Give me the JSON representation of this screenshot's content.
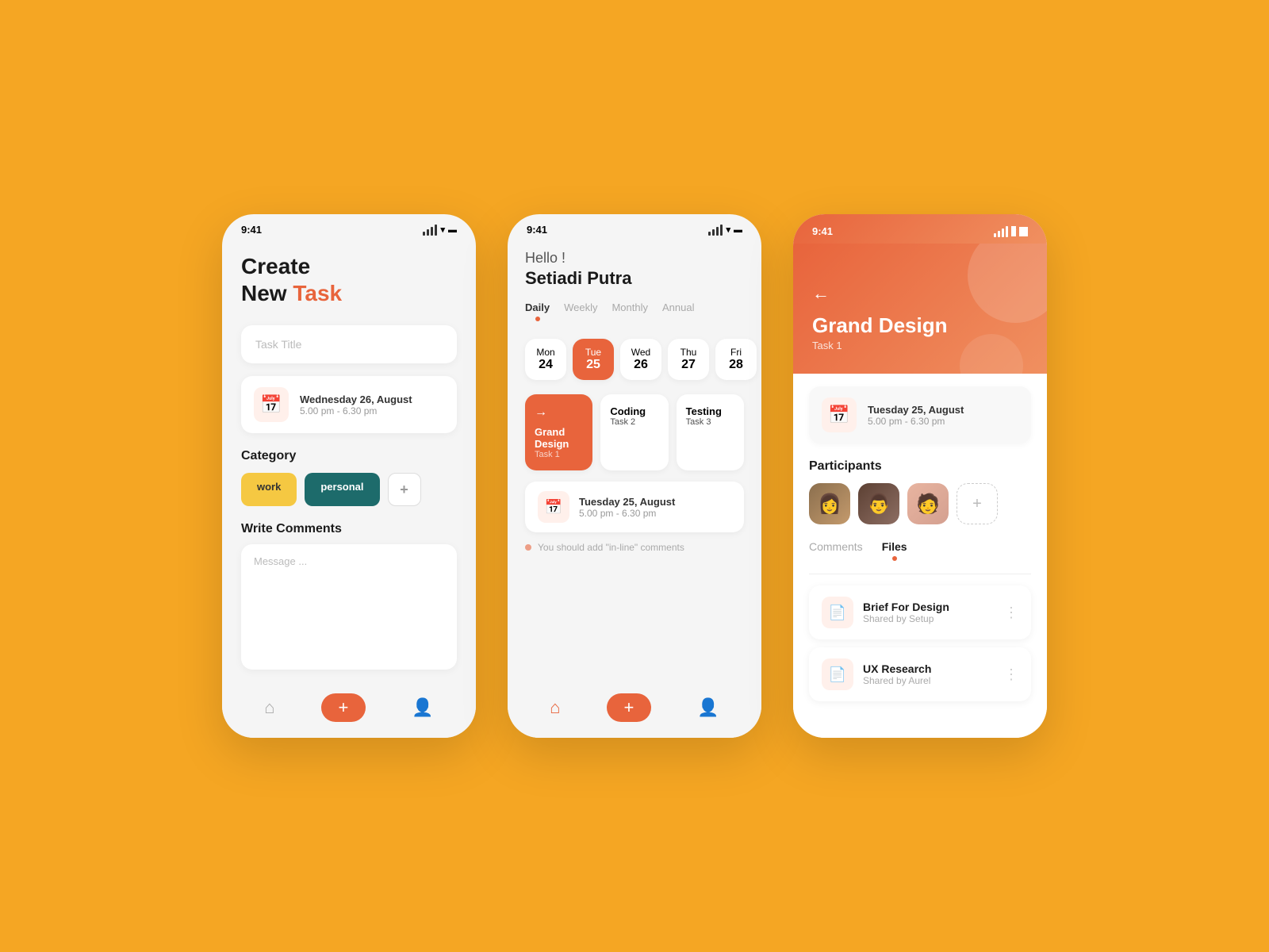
{
  "background": "#F5A623",
  "phone1": {
    "status_time": "9:41",
    "title_line1": "Create",
    "title_line2": "New ",
    "title_highlight": "Task",
    "task_input_placeholder": "Task Title",
    "date_main": "Wednesday 26, August",
    "date_sub": "5.00 pm - 6.30 pm",
    "category_label": "Category",
    "tag_work": "work",
    "tag_personal": "personal",
    "comments_label": "Write Comments",
    "message_placeholder": "Message ..."
  },
  "phone2": {
    "status_time": "9:41",
    "greeting": "Hello !",
    "user_name": "Setiadi Putra",
    "filter_tabs": [
      "Daily",
      "Weekly",
      "Monthly",
      "Annual"
    ],
    "active_tab": "Daily",
    "days": [
      {
        "name": "Mon",
        "num": "24",
        "active": false
      },
      {
        "name": "Tue",
        "num": "25",
        "active": true
      },
      {
        "name": "Wed",
        "num": "26",
        "active": false
      },
      {
        "name": "Thu",
        "num": "27",
        "active": false
      },
      {
        "name": "Fri",
        "num": "28",
        "active": false
      }
    ],
    "tasks": [
      {
        "name": "Grand Design",
        "sub": "Task 1",
        "featured": true,
        "arrow": "→"
      },
      {
        "name": "Coding",
        "sub": "Task 2",
        "featured": false
      },
      {
        "name": "Testing",
        "sub": "Task 3",
        "featured": false
      }
    ],
    "event_date": "Tuesday 25, August",
    "event_time": "5.00 pm - 6.30 pm",
    "comment_hint": "You should add \"in-line\" comments"
  },
  "phone3": {
    "status_time": "9:41",
    "project_title": "Grand Design",
    "project_sub": "Task 1",
    "date_main": "Tuesday 25, August",
    "date_sub": "5.00 pm - 6.30 pm",
    "participants_label": "Participants",
    "tabs": [
      "Comments",
      "Files"
    ],
    "active_tab": "Files",
    "files": [
      {
        "name": "Brief For Design",
        "shared_by": "Shared by Setup"
      },
      {
        "name": "UX Research",
        "shared_by": "Shared by Aurel"
      }
    ]
  }
}
